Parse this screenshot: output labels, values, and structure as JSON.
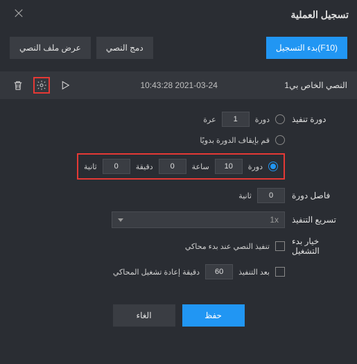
{
  "title": "تسجيل العملية",
  "toolbar": {
    "start_record": "(F10)بدء التسجيل",
    "merge_script": "دمج النصي",
    "view_script_file": "عرض ملف النصي"
  },
  "script": {
    "name": "النصي الخاص بي1",
    "datetime": "2021-03-24 10:43:28"
  },
  "form": {
    "exec_cycle_label": "دورة تنفيذ",
    "times_unit": "عرة",
    "times_value": "1",
    "cycle_word": "دورة",
    "stop_manual_label": "قم بإيقاف الدورة بدويًا",
    "second_label": "ثانية",
    "second_value": "0",
    "minute_label": "دقيقة",
    "minute_value": "0",
    "hour_label": "ساعة",
    "hour_value": "10",
    "cycle_interval_label": "فاصل دورة",
    "interval_value": "0",
    "interval_unit": "ثانية",
    "speed_label": "تسريع التنفيذ",
    "speed_value": "1x",
    "startup_label": "خيار بدء التشغيل",
    "exec_on_start": "تنفيذ النصي عند بدء محاكي",
    "restart_after_value": "60",
    "restart_after_unit": "بعد التنفيذ",
    "restart_emulator": "دقيقة إعادة تشغيل المحاكي"
  },
  "footer": {
    "save": "حفظ",
    "cancel": "الغاء"
  }
}
